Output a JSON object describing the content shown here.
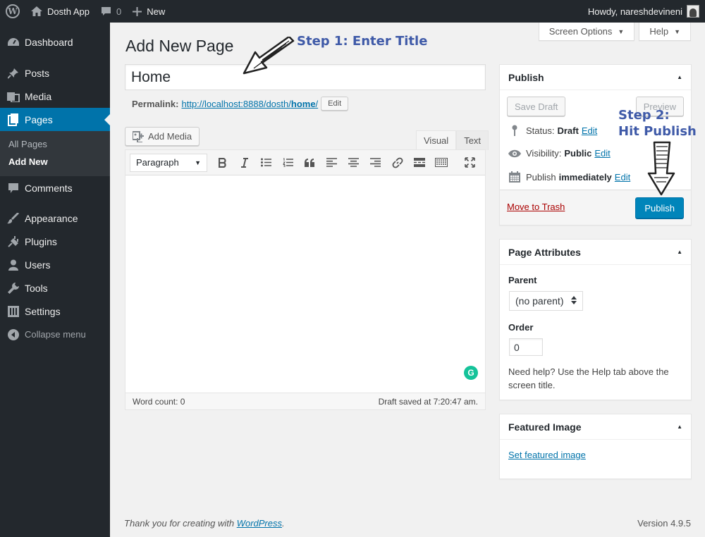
{
  "adminbar": {
    "site_name": "Dosth App",
    "comments_count": "0",
    "new_label": "New",
    "howdy": "Howdy, nareshdevineni"
  },
  "sidebar": {
    "items": [
      {
        "label": "Dashboard",
        "icon": "dashboard-icon"
      },
      {
        "label": "Posts",
        "icon": "pin-icon"
      },
      {
        "label": "Media",
        "icon": "media-icon"
      },
      {
        "label": "Pages",
        "icon": "pages-icon",
        "active": true
      },
      {
        "label": "Comments",
        "icon": "comment-icon"
      },
      {
        "label": "Appearance",
        "icon": "brush-icon"
      },
      {
        "label": "Plugins",
        "icon": "plug-icon"
      },
      {
        "label": "Users",
        "icon": "user-icon"
      },
      {
        "label": "Tools",
        "icon": "wrench-icon"
      },
      {
        "label": "Settings",
        "icon": "settings-icon"
      }
    ],
    "submenu": [
      "All Pages",
      "Add New"
    ],
    "collapse_label": "Collapse menu"
  },
  "screen_tabs": {
    "screen_options": "Screen Options",
    "help": "Help"
  },
  "main": {
    "page_title": "Add New Page",
    "title_value": "Home",
    "permalink_label": "Permalink:",
    "permalink_base": "http://localhost:8888/dosth/",
    "permalink_slug": "home",
    "permalink_end": "/",
    "edit_label": "Edit",
    "add_media": "Add Media",
    "tab_visual": "Visual",
    "tab_text": "Text",
    "format_value": "Paragraph",
    "word_count": "Word count: 0",
    "draft_saved": "Draft saved at 7:20:47 am."
  },
  "publish_box": {
    "title": "Publish",
    "save_draft": "Save Draft",
    "preview": "Preview",
    "status_label": "Status:",
    "status_value": "Draft",
    "visibility_label": "Visibility:",
    "visibility_value": "Public",
    "publish_label": "Publish",
    "publish_value": "immediately",
    "edit": "Edit",
    "trash": "Move to Trash",
    "publish_button": "Publish"
  },
  "attributes_box": {
    "title": "Page Attributes",
    "parent_label": "Parent",
    "parent_value": "(no parent)",
    "order_label": "Order",
    "order_value": "0",
    "help": "Need help? Use the Help tab above the screen title."
  },
  "featured_box": {
    "title": "Featured Image",
    "link": "Set featured image"
  },
  "footer": {
    "thanks_prefix": "Thank you for creating with ",
    "thanks_link": "WordPress",
    "thanks_suffix": ".",
    "version": "Version 4.9.5"
  },
  "annotations": {
    "step1": "Step 1: Enter Title",
    "step2_line1": "Step 2:",
    "step2_line2": "Hit Publish"
  },
  "colors": {
    "accent": "#0073aa",
    "publish_button": "#0085ba",
    "sidebar_bg": "#23282d",
    "annotation": "#3f5aa8"
  }
}
